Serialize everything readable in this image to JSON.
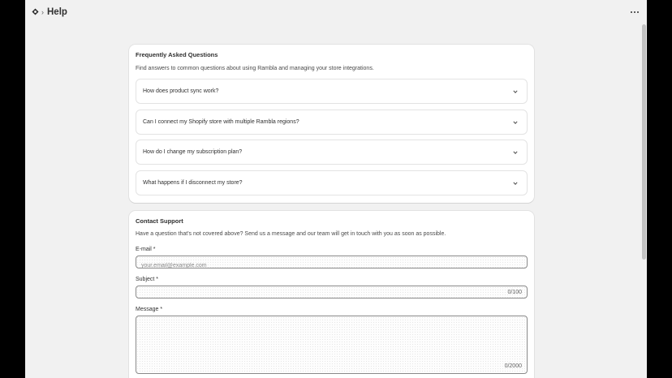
{
  "header": {
    "title": "Help",
    "app_icon": "rambla-logo-icon",
    "separator_icon": "chevron-right-icon",
    "more_icon": "ellipsis-icon"
  },
  "faq": {
    "title": "Frequently Asked Questions",
    "description": "Find answers to common questions about using Rambla and managing your store integrations.",
    "items": [
      {
        "question": "How does product sync work?"
      },
      {
        "question": "Can I connect my Shopify store with multiple Rambla regions?"
      },
      {
        "question": "How do I change my subscription plan?"
      },
      {
        "question": "What happens if I disconnect my store?"
      }
    ]
  },
  "contact": {
    "title": "Contact Support",
    "description": "Have a question that's not covered above? Send us a message and our team will get in touch with you as soon as possible.",
    "email": {
      "label": "E-mail *",
      "placeholder": "your.email@example.com",
      "value": ""
    },
    "subject": {
      "label": "Subject *",
      "value": "",
      "counter": "0/100"
    },
    "message": {
      "label": "Message *",
      "value": "",
      "counter": "0/2000"
    }
  },
  "colors": {
    "background": "#f1f1f1",
    "card": "#ffffff",
    "text": "#303030",
    "border": "#8a8a8a"
  }
}
